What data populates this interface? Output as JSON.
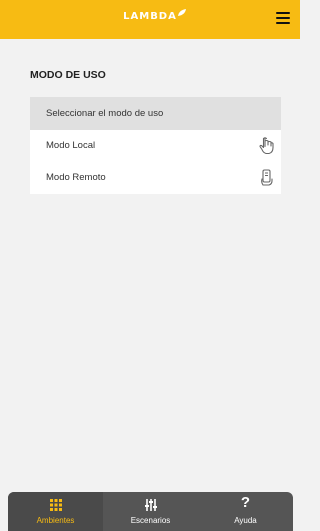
{
  "header": {
    "logo_text": "LAMBDA",
    "menu_icon": "hamburger-menu-icon"
  },
  "main": {
    "section_title": "MODO DE USO",
    "card": {
      "header": "Seleccionar el modo de uso",
      "items": [
        {
          "label": "Modo Local",
          "icon": "hand-pointer-icon"
        },
        {
          "label": "Modo Remoto",
          "icon": "remote-control-hand-icon"
        }
      ]
    }
  },
  "bottom_nav": {
    "items": [
      {
        "label": "Ambientes",
        "icon": "grid-icon",
        "active": true
      },
      {
        "label": "Escenarios",
        "icon": "sliders-icon",
        "active": false
      },
      {
        "label": "Ayuda",
        "icon": "question-icon",
        "active": false
      }
    ]
  },
  "colors": {
    "accent": "#f7bb13",
    "nav_bg": "#555555",
    "page_bg": "#f2f2f2"
  }
}
